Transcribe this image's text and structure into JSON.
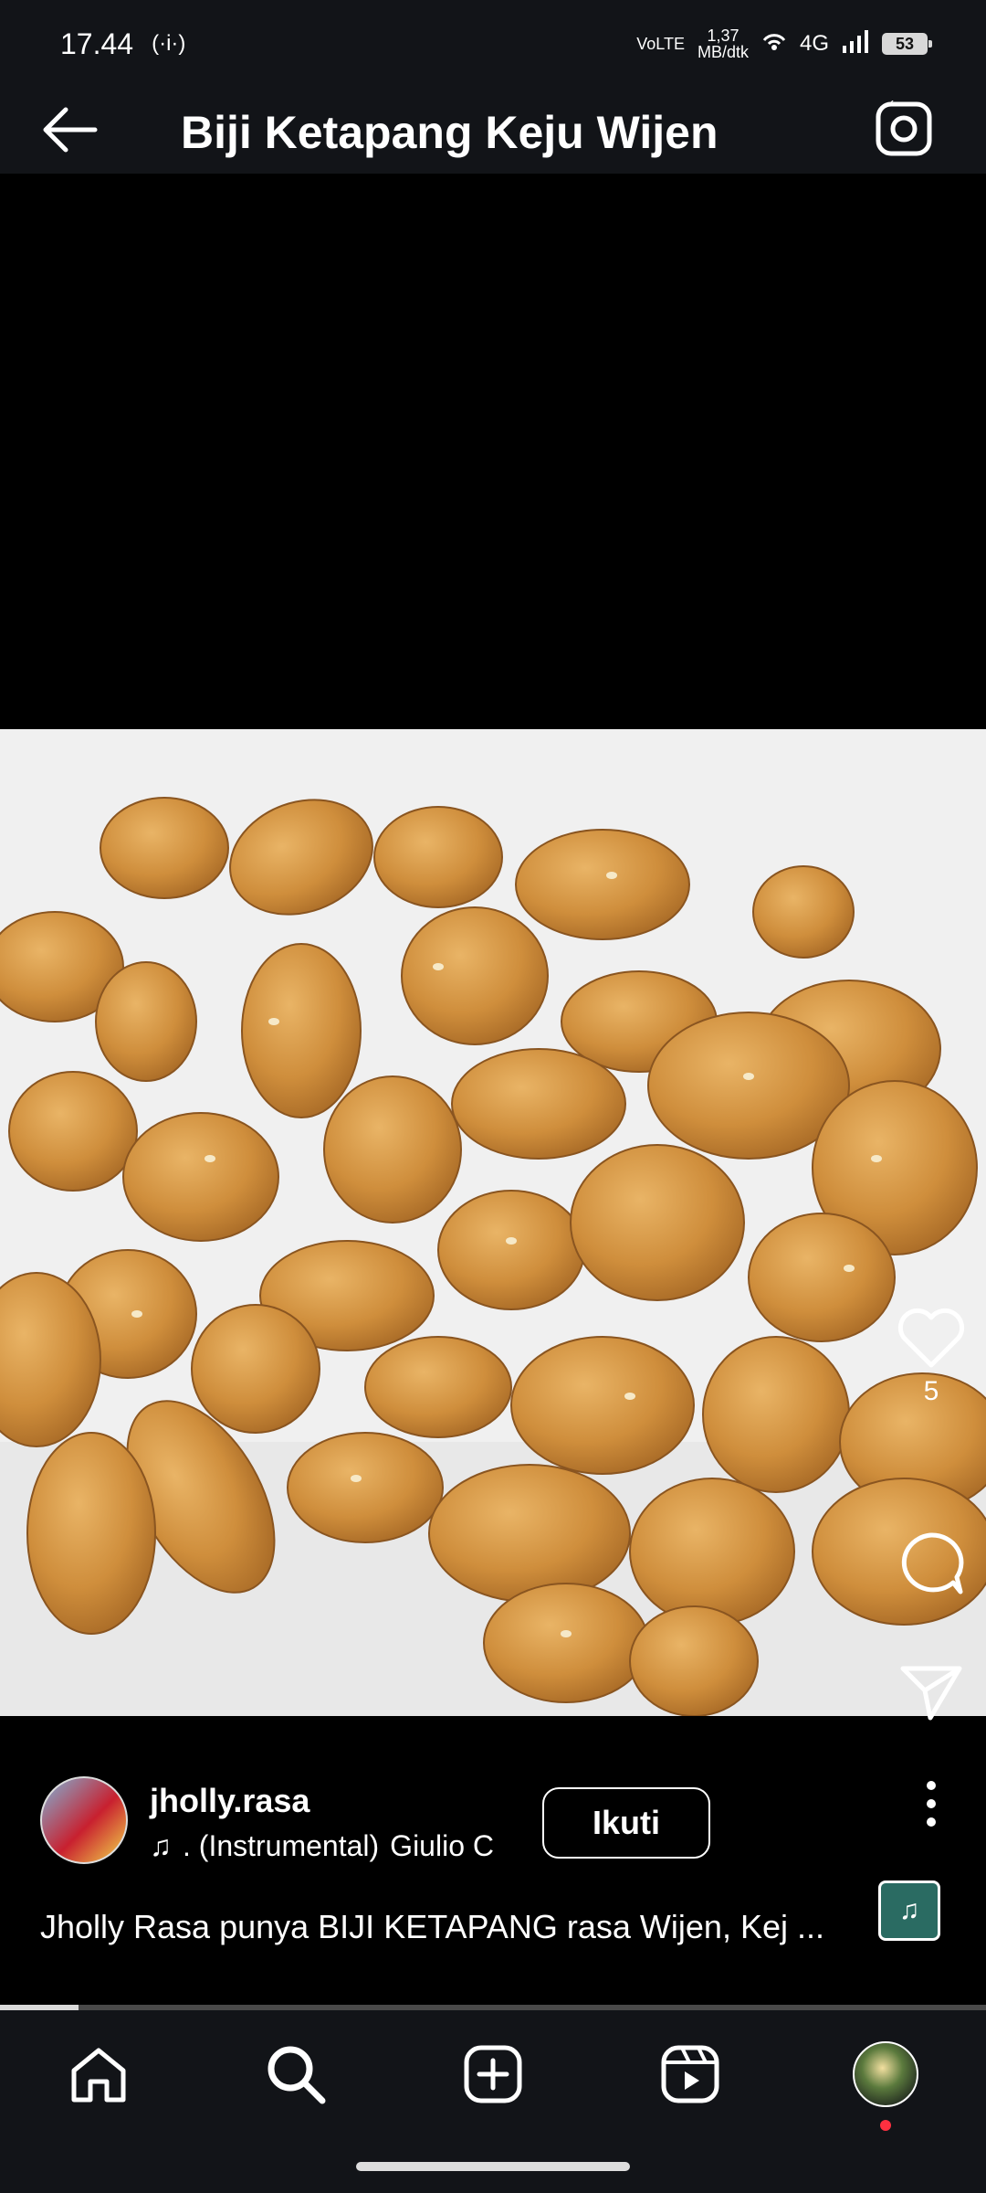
{
  "status_bar": {
    "time": "17.44",
    "network_speed_value": "1,37",
    "network_speed_unit": "MB/dtk",
    "volte": "VoLTE",
    "network_type": "4G",
    "battery": "53"
  },
  "header": {
    "title": "Biji Ketapang Keju Wijen"
  },
  "post": {
    "like_count": "5",
    "username": "jholly.rasa",
    "audio_text": ". (Instrumental)",
    "audio_artist": "Giulio C",
    "follow_label": "Ikuti",
    "caption": "Jholly Rasa punya BIJI KETAPANG rasa Wijen, Kej ...",
    "progress": 0.08
  },
  "colors": {
    "bar_bg": "#121418",
    "accent_red": "#ff3040",
    "cookie": "#d79a45"
  },
  "icons": [
    "back-arrow-icon",
    "camera-icon",
    "heart-icon",
    "comment-icon",
    "share-icon",
    "more-icon",
    "music-note-icon",
    "home-icon",
    "search-icon",
    "add-icon",
    "reels-icon"
  ]
}
